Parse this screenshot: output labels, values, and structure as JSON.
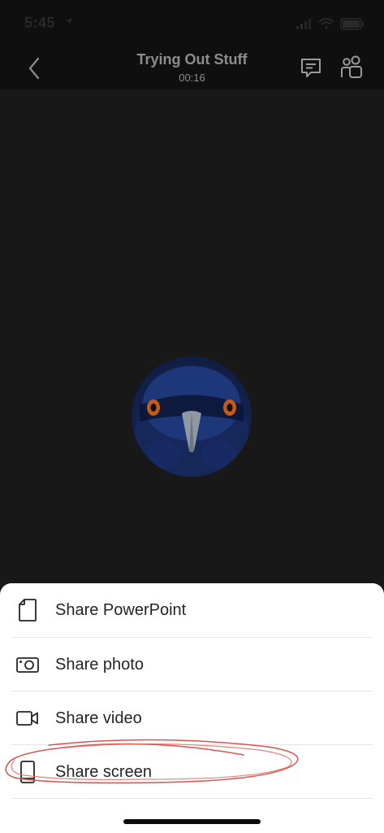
{
  "status_bar": {
    "time": "5:45",
    "icons": [
      "location-arrow-icon",
      "cellular-signal-icon",
      "wifi-icon",
      "battery-icon"
    ]
  },
  "header": {
    "title": "Trying Out Stuff",
    "subtitle": "00:16",
    "back_icon": "chevron-left-icon",
    "chat_icon": "chat-icon",
    "people_icon": "people-icon"
  },
  "participant": {
    "avatar_description": "blue bird"
  },
  "share_menu": {
    "items": [
      {
        "label": "Share PowerPoint",
        "icon": "document-icon"
      },
      {
        "label": "Share photo",
        "icon": "camera-icon"
      },
      {
        "label": "Share video",
        "icon": "video-camera-icon"
      },
      {
        "label": "Share screen",
        "icon": "phone-screen-icon"
      }
    ]
  },
  "colors": {
    "background": "#181818",
    "header_background": "#0f0f0f",
    "header_text": "#8d8d8d",
    "sheet_background": "#ffffff",
    "sheet_text": "#242424",
    "annotation_red": "#d9534f"
  }
}
